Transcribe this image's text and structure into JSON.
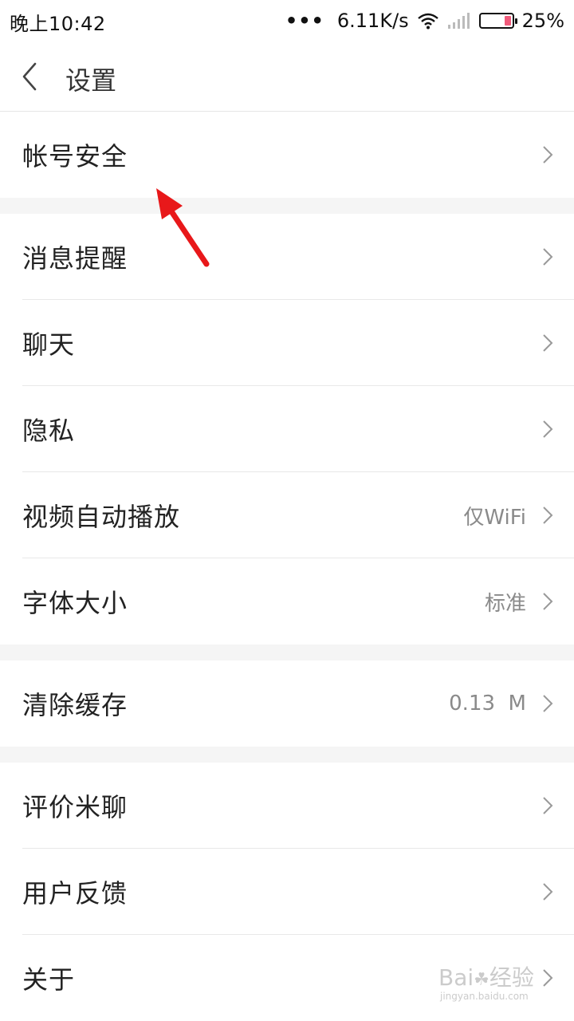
{
  "status_bar": {
    "time": "晚上10:42",
    "net_speed": "6.11K/s",
    "battery_pct": "25%",
    "battery_color": "#f05a7a"
  },
  "header": {
    "title": "设置",
    "back_icon": "chevron-left-icon"
  },
  "groups": [
    {
      "items": [
        {
          "label": "帐号安全",
          "value": ""
        }
      ]
    },
    {
      "items": [
        {
          "label": "消息提醒",
          "value": ""
        },
        {
          "label": "聊天",
          "value": ""
        },
        {
          "label": "隐私",
          "value": ""
        },
        {
          "label": "视频自动播放",
          "value": "仅WiFi"
        },
        {
          "label": "字体大小",
          "value": "标准"
        }
      ]
    },
    {
      "items": [
        {
          "label": "清除缓存",
          "value": "0.13  M"
        }
      ]
    },
    {
      "items": [
        {
          "label": "评价米聊",
          "value": ""
        },
        {
          "label": "用户反馈",
          "value": ""
        },
        {
          "label": "关于",
          "value": ""
        }
      ]
    }
  ],
  "watermark": {
    "logo": "Bai 经验",
    "url": "jingyan.baidu.com"
  },
  "colors": {
    "annotation_arrow": "#e8181a",
    "divider": "#e8e8e8",
    "group_gap": "#f5f5f5"
  }
}
